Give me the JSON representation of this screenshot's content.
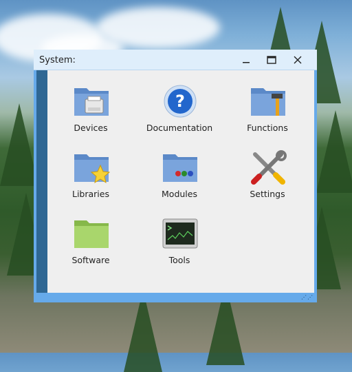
{
  "window": {
    "title": "System:",
    "controls": {
      "minimize": "minimize-icon",
      "maximize": "maximize-icon",
      "close": "close-icon"
    }
  },
  "items": [
    {
      "label": "Devices",
      "icon": "printer-folder-icon"
    },
    {
      "label": "Documentation",
      "icon": "help-icon"
    },
    {
      "label": "Functions",
      "icon": "hammer-folder-icon"
    },
    {
      "label": "Libraries",
      "icon": "star-folder-icon"
    },
    {
      "label": "Modules",
      "icon": "modules-folder-icon"
    },
    {
      "label": "Settings",
      "icon": "tools-icon"
    },
    {
      "label": "Software",
      "icon": "green-folder-icon"
    },
    {
      "label": "Tools",
      "icon": "terminal-icon"
    }
  ],
  "colors": {
    "accent": "#66aaea",
    "sidebar": "#2f6793",
    "content_bg": "#efefef",
    "folder_blue": "#5b89c8",
    "folder_green": "#9ccc5f"
  }
}
